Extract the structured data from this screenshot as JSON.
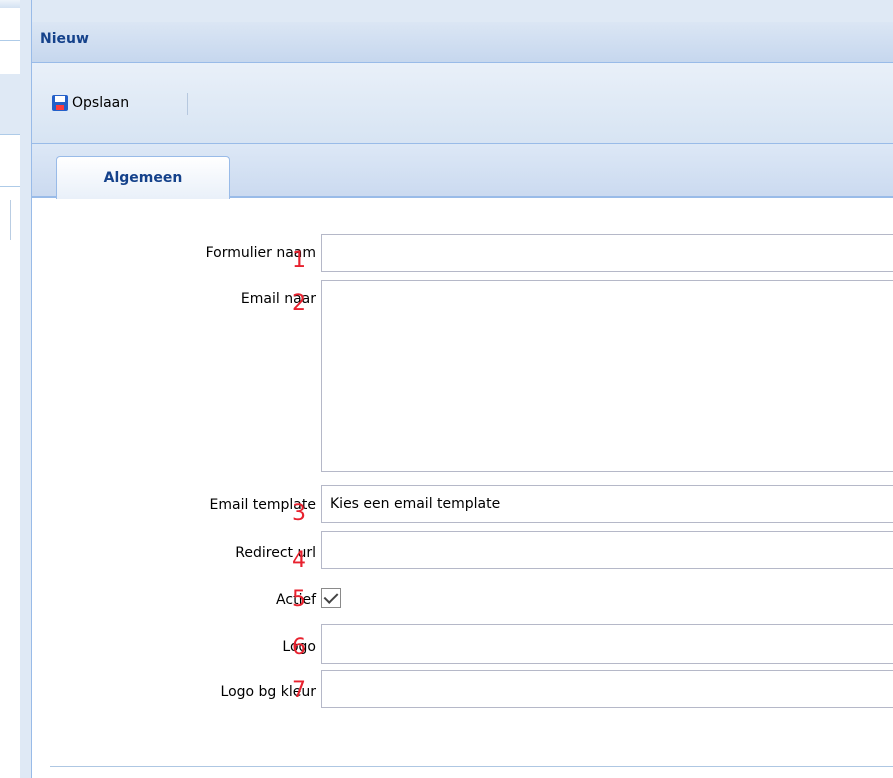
{
  "window": {
    "title": "Nieuw"
  },
  "toolbar": {
    "save_label": "Opslaan"
  },
  "tabs": [
    {
      "label": "Algemeen"
    }
  ],
  "form": {
    "fields": [
      {
        "label": "Formulier naam",
        "number": "1",
        "value": ""
      },
      {
        "label": "Email naar",
        "number": "2",
        "value": ""
      },
      {
        "label": "Email template",
        "number": "3",
        "value": "Kies een email template"
      },
      {
        "label": "Redirect url",
        "number": "4",
        "value": ""
      },
      {
        "label": "Actief",
        "number": "5",
        "checked": true
      },
      {
        "label": "Logo",
        "number": "6",
        "value": ""
      },
      {
        "label": "Logo bg kleur",
        "number": "7",
        "value": ""
      }
    ]
  },
  "colors": {
    "header_text": "#15428b",
    "annotation_red": "#e8212e",
    "border_blue": "#99bbe8"
  }
}
